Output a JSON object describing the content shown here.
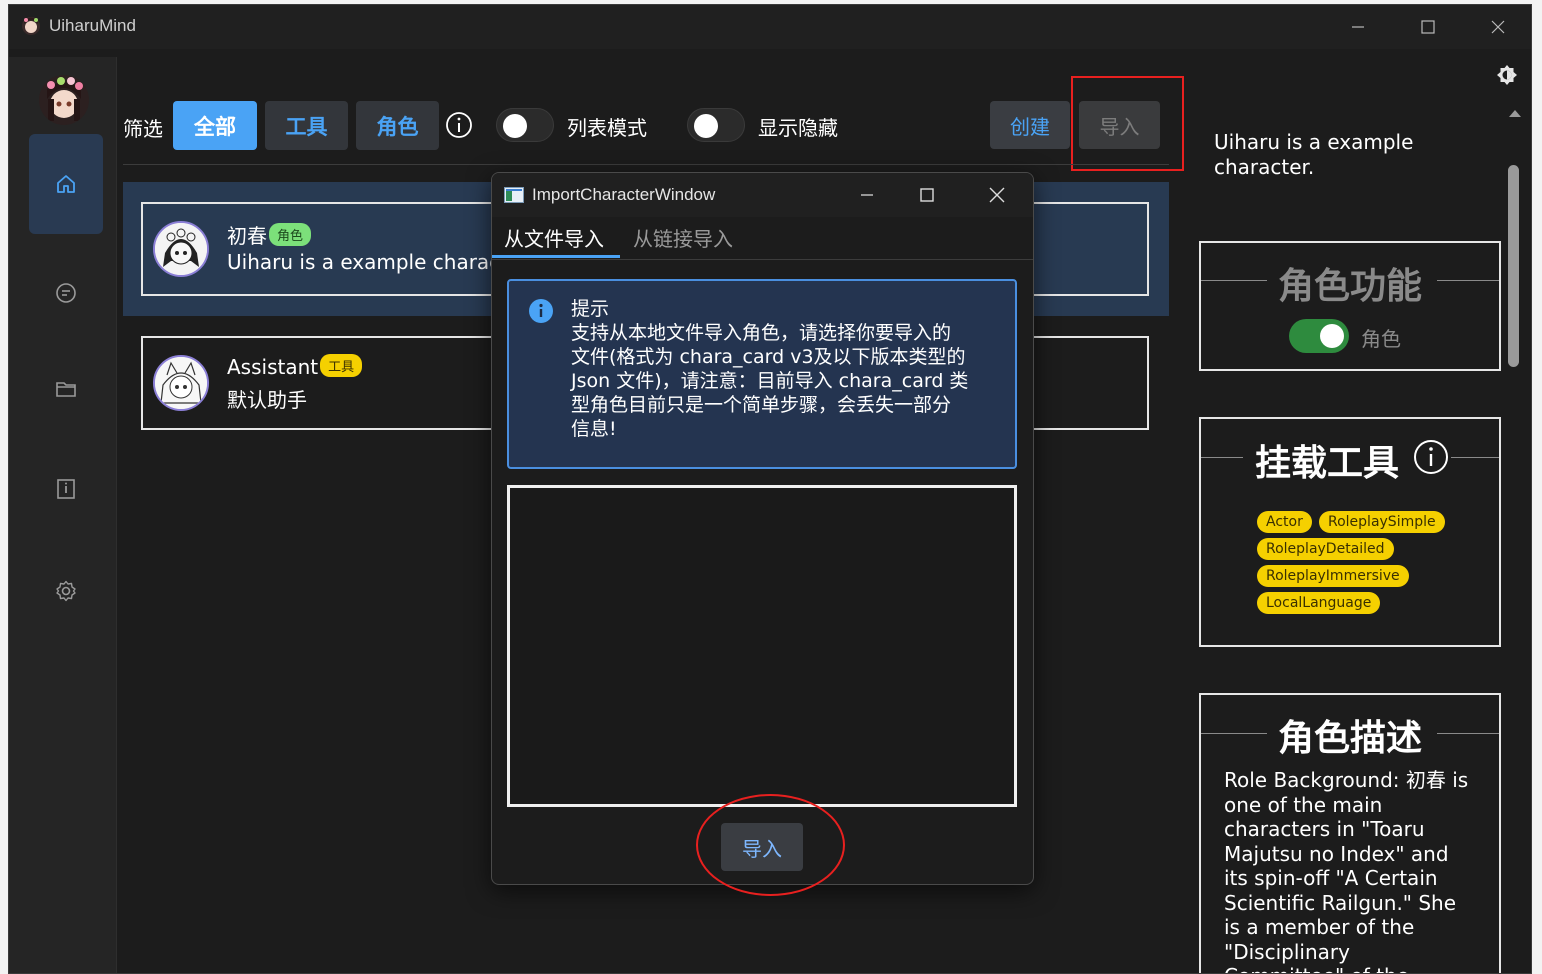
{
  "window": {
    "title": "UiharuMind"
  },
  "toolbar": {
    "filter_label": "筛选",
    "chip_all": "全部",
    "chip_tools": "工具",
    "chip_roles": "角色",
    "list_mode_label": "列表模式",
    "show_hidden_label": "显示隐藏",
    "create_label": "创建",
    "import_label": "导入"
  },
  "characters": [
    {
      "name": "初春",
      "tag": "角色",
      "desc": "Uiharu is a example character."
    },
    {
      "name": "Assistant",
      "tag": "工具",
      "desc": "默认助手"
    }
  ],
  "details": {
    "description": "Uiharu is a example character.",
    "role_function_title": "角色功能",
    "role_toggle_label": "角色",
    "tools_title": "挂载工具",
    "tools": [
      "Actor",
      "RoleplaySimple",
      "RoleplayDetailed",
      "RoleplayImmersive",
      "LocalLanguage"
    ],
    "role_desc_title": "角色描述",
    "role_desc_text": "Role Background: 初春 is one of the main characters in \"Toaru Majutsu no Index\" and its spin-off \"A Certain Scientific Railgun.\" She is a member of the \"Disciplinary Committee\" of the \"Academy City\""
  },
  "dialog": {
    "title": "ImportCharacterWindow",
    "tab_file": "从文件导入",
    "tab_link": "从链接导入",
    "info_title": "提示",
    "info_line1": "支持从本地文件导入角色，请选择你要导入的",
    "info_line2": "文件(格式为 chara_card v3及以下版本类型的",
    "info_line3": "Json 文件)，请注意：目前导入 chara_card 类",
    "info_line4": "型角色目前只是一个简单步骤，会丢失一部分",
    "info_line5": "信息!",
    "import_button": "导入"
  },
  "colors": {
    "accent_blue": "#4aa3f5",
    "tag_green": "#7ce07a",
    "tag_yellow": "#f5d000",
    "highlight_red": "#e8201f"
  }
}
